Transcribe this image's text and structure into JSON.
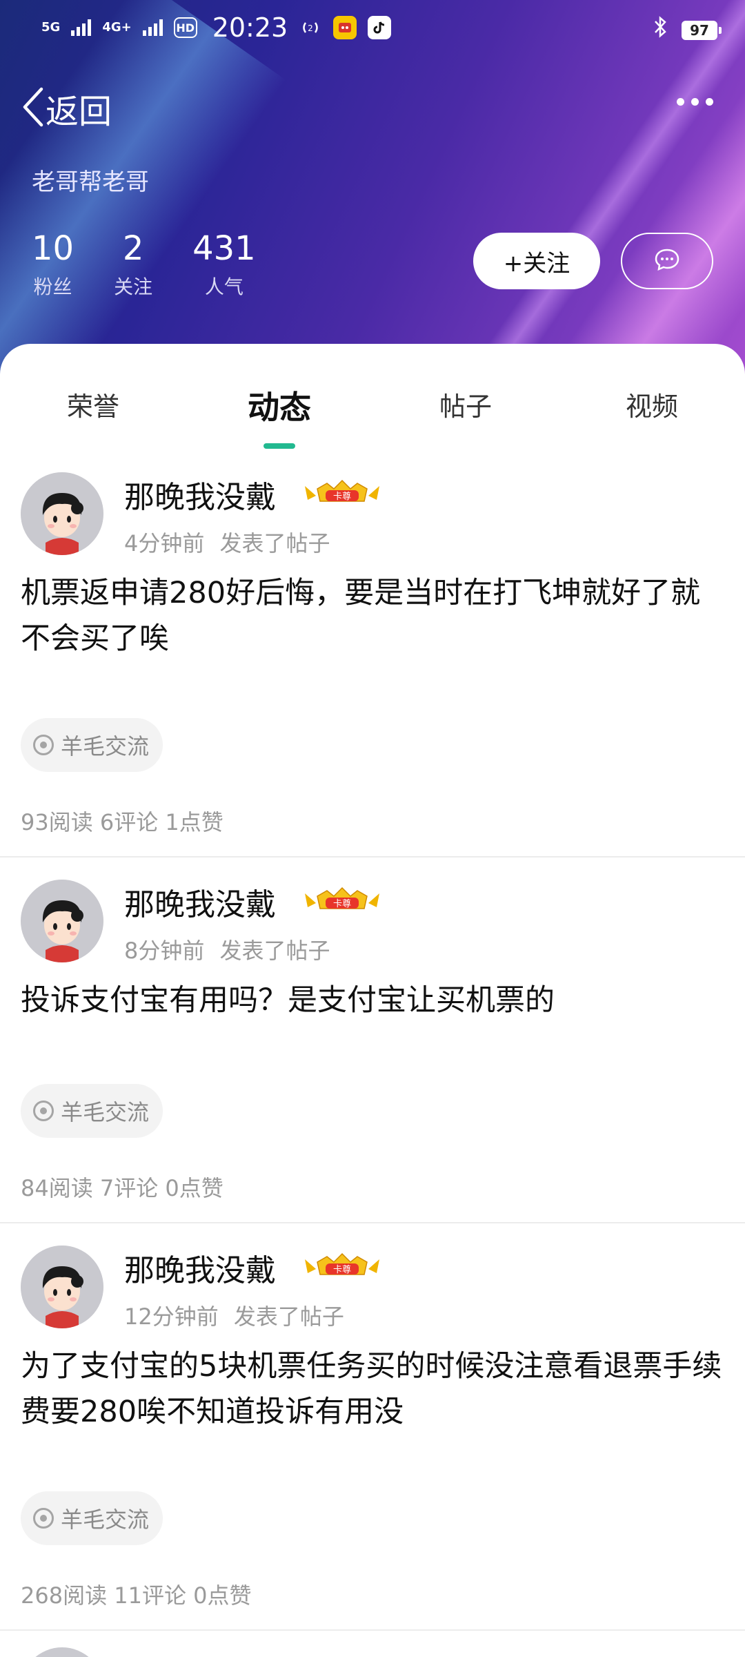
{
  "status_bar": {
    "network1": "5G",
    "network2": "4G+",
    "hd": "HD",
    "time": "20:23",
    "nfc_icon": "nfc-icon",
    "app_icon1": "game-app-icon",
    "app_icon2": "tiktok-icon",
    "bluetooth_icon": "bluetooth-icon",
    "battery": "97"
  },
  "nav": {
    "back_label": "返回",
    "back_icon": "chevron-left-icon",
    "more_icon": "more-icon"
  },
  "profile": {
    "username": "老哥帮老哥",
    "stats": [
      {
        "value": "10",
        "label": "粉丝"
      },
      {
        "value": "2",
        "label": "关注"
      },
      {
        "value": "431",
        "label": "人气"
      }
    ],
    "follow_label": "+关注",
    "message_icon": "chat-bubble-icon"
  },
  "tabs": [
    {
      "label": "荣誉"
    },
    {
      "label": "动态",
      "active": true
    },
    {
      "label": "帖子"
    },
    {
      "label": "视频"
    }
  ],
  "accent_color": "#22b990",
  "posts": [
    {
      "author": "那晚我没戴",
      "badge": "卡尊",
      "time": "4分钟前",
      "action": "发表了帖子",
      "body": "机票返申请280好后悔，要是当时在打飞坤就好了就不会买了唉",
      "tag": "羊毛交流",
      "stats": "93阅读 6评论 1点赞"
    },
    {
      "author": "那晚我没戴",
      "badge": "卡尊",
      "time": "8分钟前",
      "action": "发表了帖子",
      "body": "投诉支付宝有用吗？是支付宝让买机票的",
      "tag": "羊毛交流",
      "stats": "84阅读 7评论 0点赞"
    },
    {
      "author": "那晚我没戴",
      "badge": "卡尊",
      "time": "12分钟前",
      "action": "发表了帖子",
      "body": "为了支付宝的5块机票任务买的时候没注意看退票手续费要280唉不知道投诉有用没",
      "tag": "羊毛交流",
      "stats": "268阅读 11评论 0点赞"
    }
  ]
}
